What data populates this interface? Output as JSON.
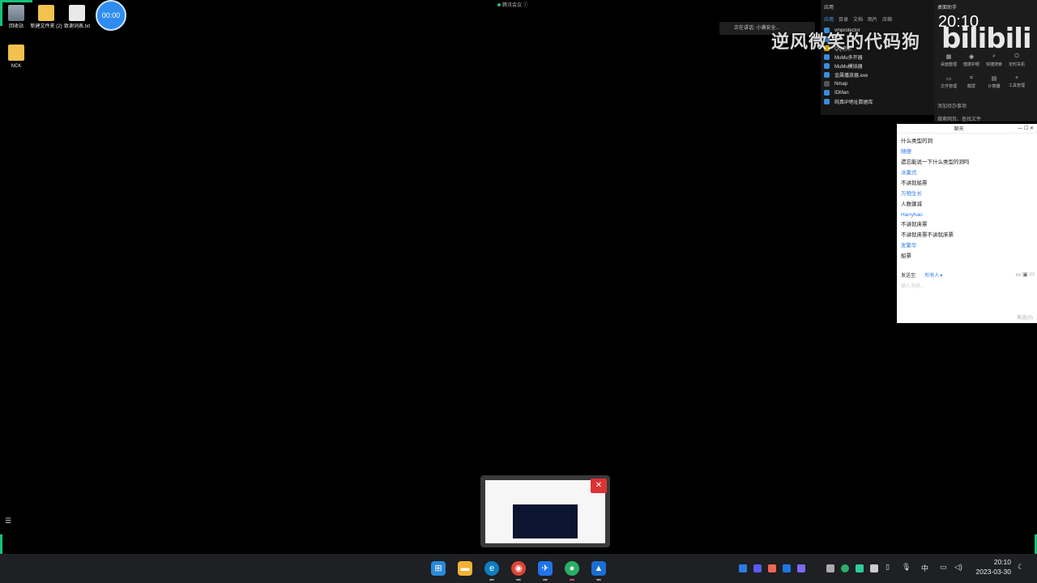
{
  "desktop": {
    "icons": [
      {
        "label": "回收站"
      },
      {
        "label": "新建文件夹 (2)"
      },
      {
        "label": "致谢词表.txt"
      },
      {
        "label": "NCK"
      }
    ],
    "timer": "00:00"
  },
  "top_status": "腾讯会议",
  "speaker_toast": "正在讲话: 小满安全...",
  "watermark": {
    "text": "逆风微笑的代码狗",
    "logo": "bilibili"
  },
  "app_panel": {
    "header": "应用",
    "tabs": [
      "应用",
      "目录",
      "文档",
      "图片",
      "压缩"
    ],
    "apps": [
      "vmprotector",
      "...",
      "QQ音乐",
      "MuMu多开器",
      "MuMu模拟器",
      "金属播放器.exe",
      "Nmap",
      "IDMan",
      "纯真IP地址数据库"
    ]
  },
  "right_panel": {
    "title": "桌面助手",
    "time": "20:10",
    "tools": [
      "桌面整理",
      "健康护眼",
      "快捷搜索",
      "定时关机",
      "文件管理",
      "截屏",
      "计算器",
      "工具管理"
    ],
    "add_event": "添加待办事项",
    "search": "搜索网页、查找文件"
  },
  "chat": {
    "title": "聊天",
    "messages": [
      {
        "type": "text",
        "text": "什么类型的洞"
      },
      {
        "type": "name",
        "text": "随便"
      },
      {
        "type": "text",
        "text": "遗忘能说一下什么类型的洞吗"
      },
      {
        "type": "name",
        "text": "冰菓式"
      },
      {
        "type": "text",
        "text": "不讲就船票"
      },
      {
        "type": "name",
        "text": "万物生长"
      },
      {
        "type": "text",
        "text": "人数骤减"
      },
      {
        "type": "name",
        "text": "Harryhao"
      },
      {
        "type": "text",
        "text": "不讲就床票"
      },
      {
        "type": "text",
        "text": "不讲就床票不讲就床票"
      },
      {
        "type": "name",
        "text": "发繁华"
      },
      {
        "type": "text",
        "text": "船票"
      }
    ],
    "send_to_label": "发送至:",
    "send_to_value": "所有人",
    "input_placeholder": "输入消息...",
    "send_button": "发送(S)"
  },
  "taskbar": {
    "apps": [
      "start-icon",
      "file-explorer-icon",
      "edge-icon",
      "chrome-icon",
      "tencent-meeting-icon",
      "wechat-icon",
      "app-icon"
    ],
    "ime": "中",
    "time": "20:10",
    "date": "2023-03-30"
  }
}
